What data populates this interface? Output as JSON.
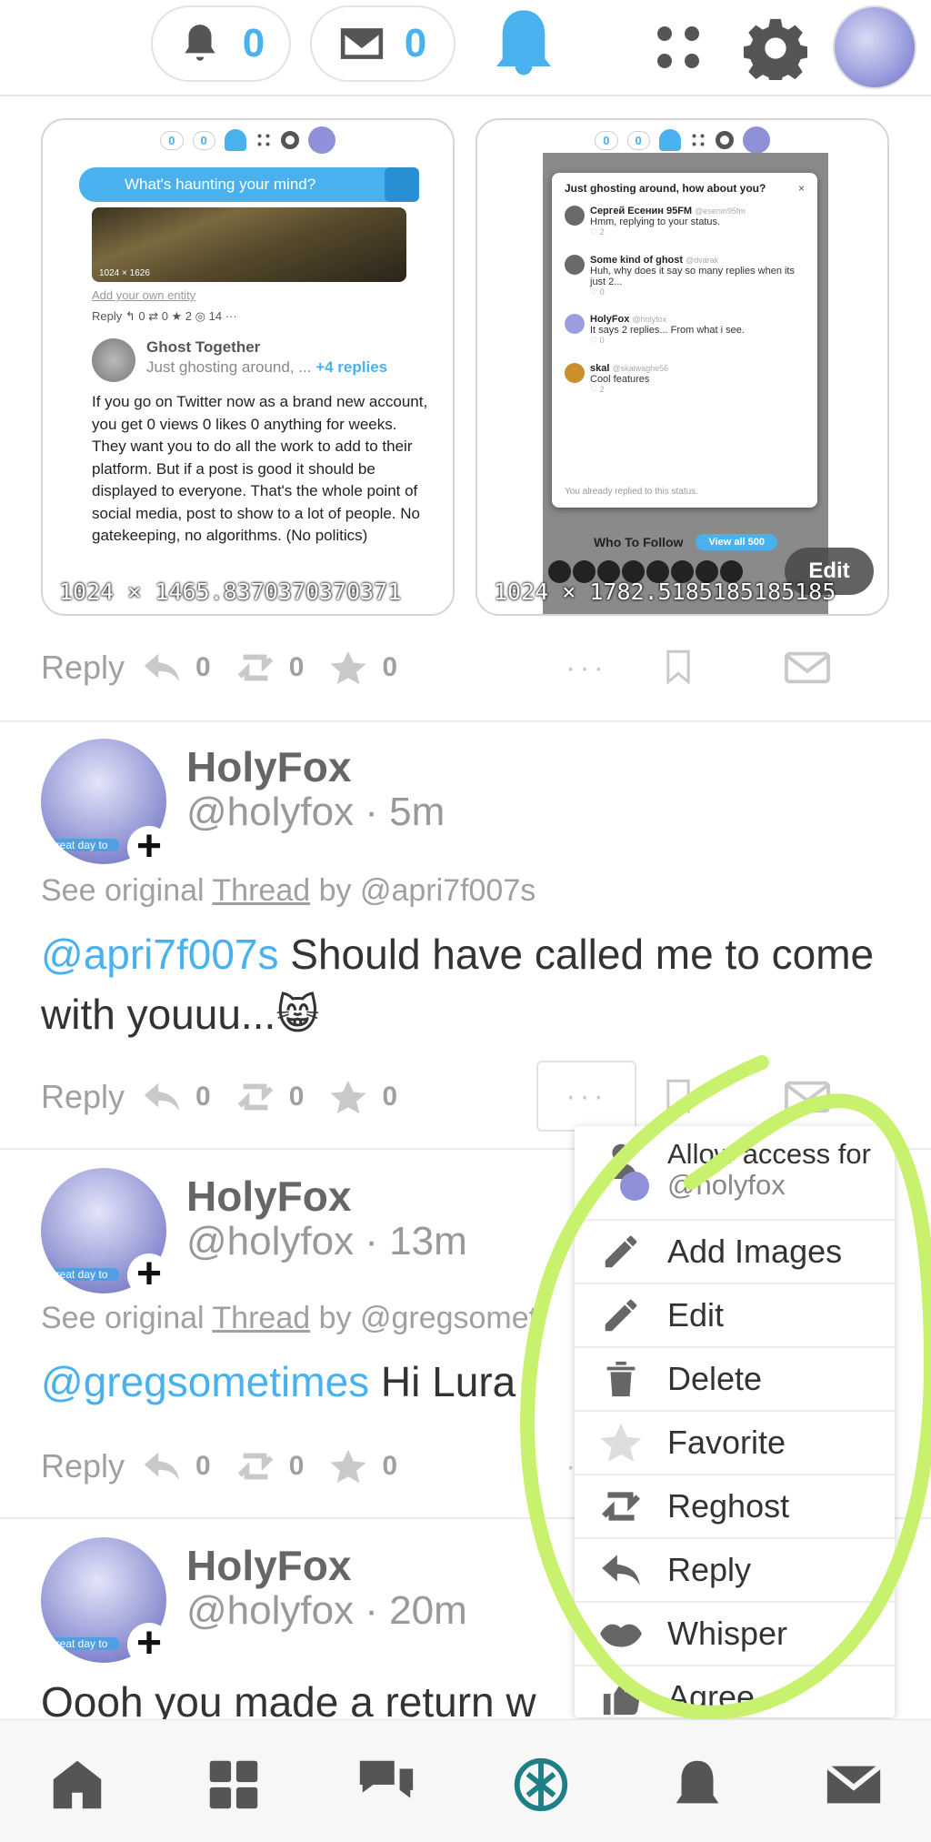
{
  "topbar": {
    "notifications_count": "0",
    "messages_count": "0"
  },
  "attachments": [
    {
      "dimensions": "1024 × 1465.8370370370371",
      "mini_counts": [
        "0",
        "0"
      ],
      "search_placeholder": "What's haunting your mind?",
      "image_caption": "1024 × 1626",
      "add_entity_link": "Add your own entity",
      "actions_text": "Reply ↰ 0   ⇄ 0   ★ 2   ◎ 14   ···",
      "author_name": "Ghost Together",
      "author_sub": "Just ghosting around, ...",
      "replies_link": "+4 replies",
      "body": "If you go on Twitter now as a brand new account, you get 0 views 0 likes 0 anything for weeks. They want you to do all the work to add to their platform. But if a post is good it should be displayed to everyone. That's the whole point of social media, post to show to a lot of people. No gatekeeping, no algorithms. (No politics)"
    },
    {
      "dimensions": "1024 × 1782.5185185185185",
      "mini_counts": [
        "0",
        "0"
      ],
      "modal_title": "Just ghosting around, how about you?",
      "close_symbol": "×",
      "replies": [
        {
          "name": "Сергей Есенин 95FM",
          "handle": "@esenin95fm",
          "text": "Hmm, replying to your status.",
          "likes": "♡ 2"
        },
        {
          "name": "Some kind of ghost",
          "handle": "@dvarak",
          "text": "Huh, why does it say so many replies when its just 2...",
          "likes": "♡ 0"
        },
        {
          "name": "HolyFox",
          "handle": "@holyfox",
          "text": "It says 2 replies... From what i see.",
          "likes": "♡ 0"
        },
        {
          "name": "skal",
          "handle": "@skalwaghe56",
          "text": "Cool features",
          "likes": "♡ 2"
        }
      ],
      "modal_footer": "You already replied to this status.",
      "who_to_follow": "Who To Follow",
      "view_all": "View all 500",
      "edit_label": "Edit"
    }
  ],
  "posts": [
    {
      "actions": {
        "reply": "Reply",
        "reply_count": "0",
        "reghost_count": "0",
        "fav_count": "0",
        "more": "···"
      }
    },
    {
      "author": "HolyFox",
      "handle_time": "@holyfox · 5m",
      "avatar_tag": "great day to",
      "thread_prefix": "See original",
      "thread_link": "Thread",
      "thread_suffix": "by @apri7f007s",
      "mention": "@apri7f007s",
      "text": " Should have called me to come with youuu...😸",
      "actions": {
        "reply": "Reply",
        "reply_count": "0",
        "reghost_count": "0",
        "fav_count": "0",
        "more": "···"
      }
    },
    {
      "author": "HolyFox",
      "handle_time": "@holyfox · 13m",
      "avatar_tag": "great day to",
      "thread_prefix": "See original",
      "thread_link": "Thread",
      "thread_suffix": "by @gregsometi",
      "mention": "@gregsometimes",
      "text": " Hi Lura",
      "actions": {
        "reply": "Reply",
        "reply_count": "0",
        "reghost_count": "0",
        "fav_count": "0",
        "more": "···"
      }
    },
    {
      "author": "HolyFox",
      "handle_time": "@holyfox · 20m",
      "avatar_tag": "great day to",
      "text": "Oooh you made a return w"
    }
  ],
  "menu": {
    "access_label": "Allow access for",
    "access_user": "@holyfox",
    "items": [
      {
        "label": "Add Images",
        "icon": "pencil-icon"
      },
      {
        "label": "Edit",
        "icon": "pencil-icon"
      },
      {
        "label": "Delete",
        "icon": "trash-icon"
      },
      {
        "label": "Favorite",
        "icon": "star-icon"
      },
      {
        "label": "Reghost",
        "icon": "reghost-icon"
      },
      {
        "label": "Reply",
        "icon": "reply-icon"
      },
      {
        "label": "Whisper",
        "icon": "lips-icon"
      },
      {
        "label": "Agree",
        "icon": "thumbs-up-icon"
      }
    ]
  },
  "colors": {
    "accent": "#4ab1ef",
    "highlight_scribble": "#c8f26e"
  }
}
